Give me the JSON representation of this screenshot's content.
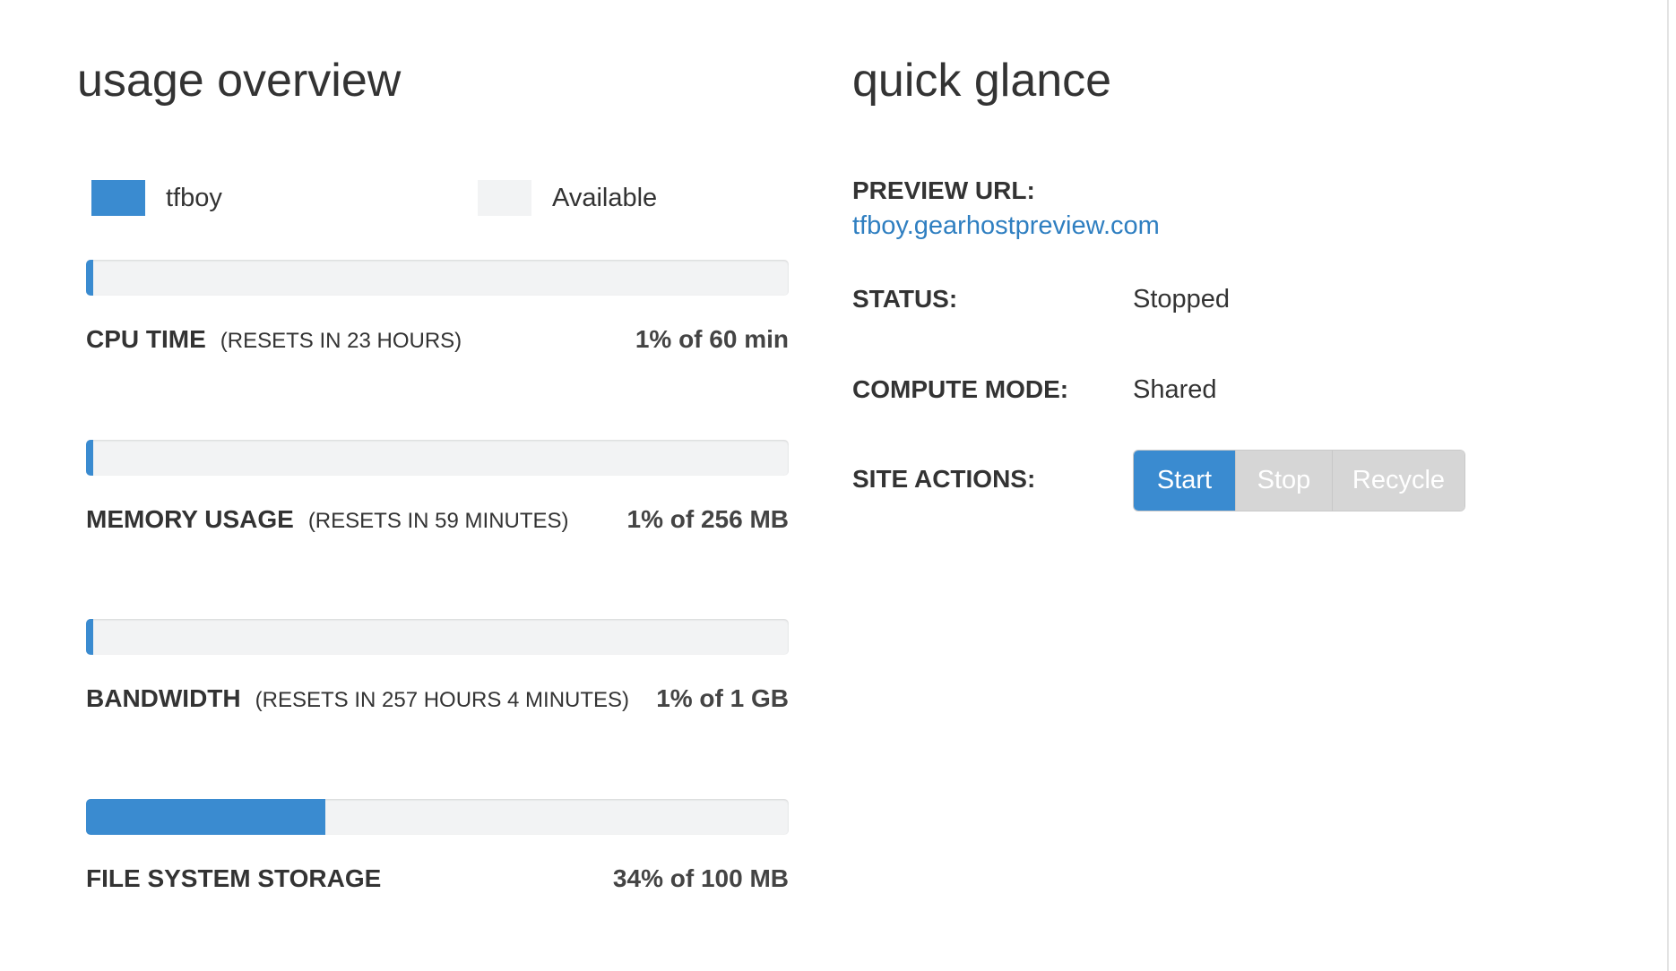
{
  "usage_overview": {
    "title": "usage overview",
    "legend": [
      {
        "label": "tfboy",
        "color": "#3a8bd0"
      },
      {
        "label": "Available",
        "color": "#f2f3f4"
      }
    ],
    "meters": [
      {
        "name": "CPU TIME",
        "reset": "(RESETS IN 23 HOURS)",
        "value_text": "1% of 60 min",
        "percent": 1
      },
      {
        "name": "MEMORY USAGE",
        "reset": "(RESETS IN 59 MINUTES)",
        "value_text": "1% of 256 MB",
        "percent": 1
      },
      {
        "name": "BANDWIDTH",
        "reset": "(RESETS IN 257 HOURS 4 MINUTES)",
        "value_text": "1% of 1 GB",
        "percent": 1
      },
      {
        "name": "FILE SYSTEM STORAGE",
        "reset": "",
        "value_text": "34% of 100 MB",
        "percent": 34
      }
    ]
  },
  "quick_glance": {
    "title": "quick glance",
    "preview_url_label": "PREVIEW URL:",
    "preview_url": "tfboy.gearhostpreview.com",
    "status_label": "STATUS:",
    "status_value": "Stopped",
    "compute_mode_label": "COMPUTE MODE:",
    "compute_mode_value": "Shared",
    "site_actions_label": "SITE ACTIONS:",
    "actions": {
      "start": "Start",
      "stop": "Stop",
      "recycle": "Recycle"
    }
  },
  "colors": {
    "accent": "#3a8bd0",
    "link": "#2f7fc1",
    "track": "#f2f3f4",
    "disabled_button": "#d6d6d6"
  }
}
